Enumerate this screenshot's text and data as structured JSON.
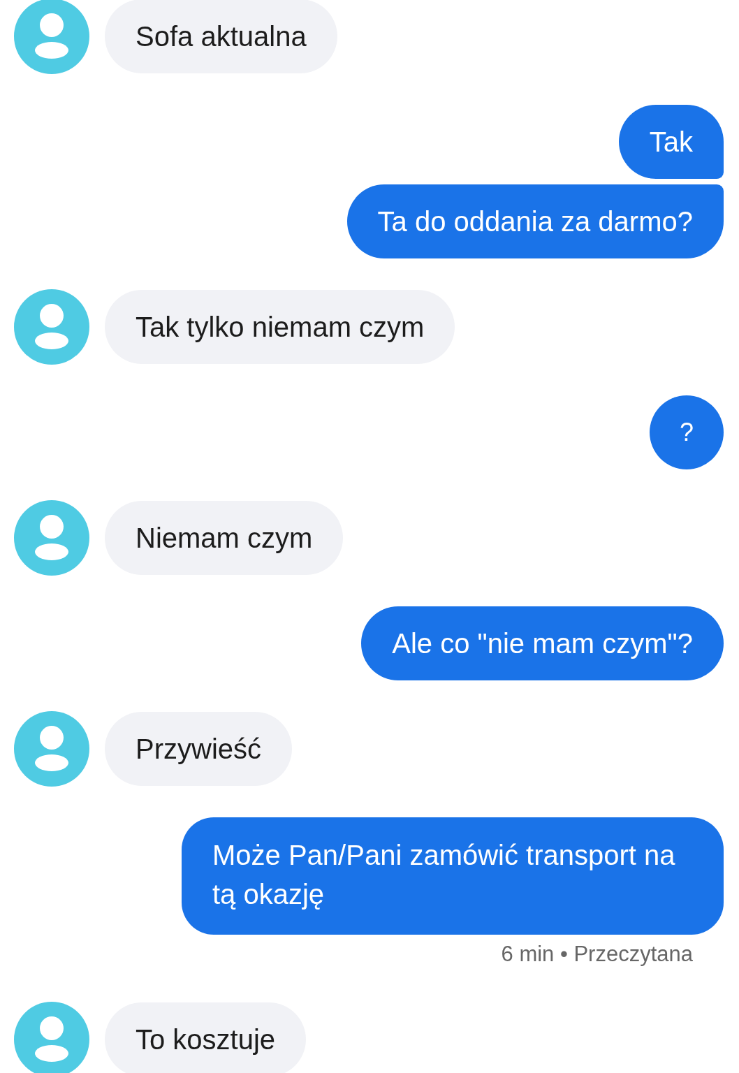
{
  "messages": [
    {
      "kind": "incoming",
      "text": "Sofa aktualna"
    },
    {
      "kind": "outgoing",
      "text": "Tak"
    },
    {
      "kind": "outgoing",
      "text": "Ta do oddania za darmo?"
    },
    {
      "kind": "incoming",
      "text": "Tak tylko niemam czym"
    },
    {
      "kind": "outgoing",
      "text": "?"
    },
    {
      "kind": "incoming",
      "text": "Niemam czym"
    },
    {
      "kind": "outgoing",
      "text": "Ale co \"nie mam czym\"?"
    },
    {
      "kind": "incoming",
      "text": "Przywieść"
    },
    {
      "kind": "outgoing",
      "text": "Może Pan/Pani zamówić transport na tą okazję"
    },
    {
      "kind": "status",
      "text": "6 min • Przeczytana"
    },
    {
      "kind": "incoming",
      "text": "To kosztuje"
    }
  ]
}
